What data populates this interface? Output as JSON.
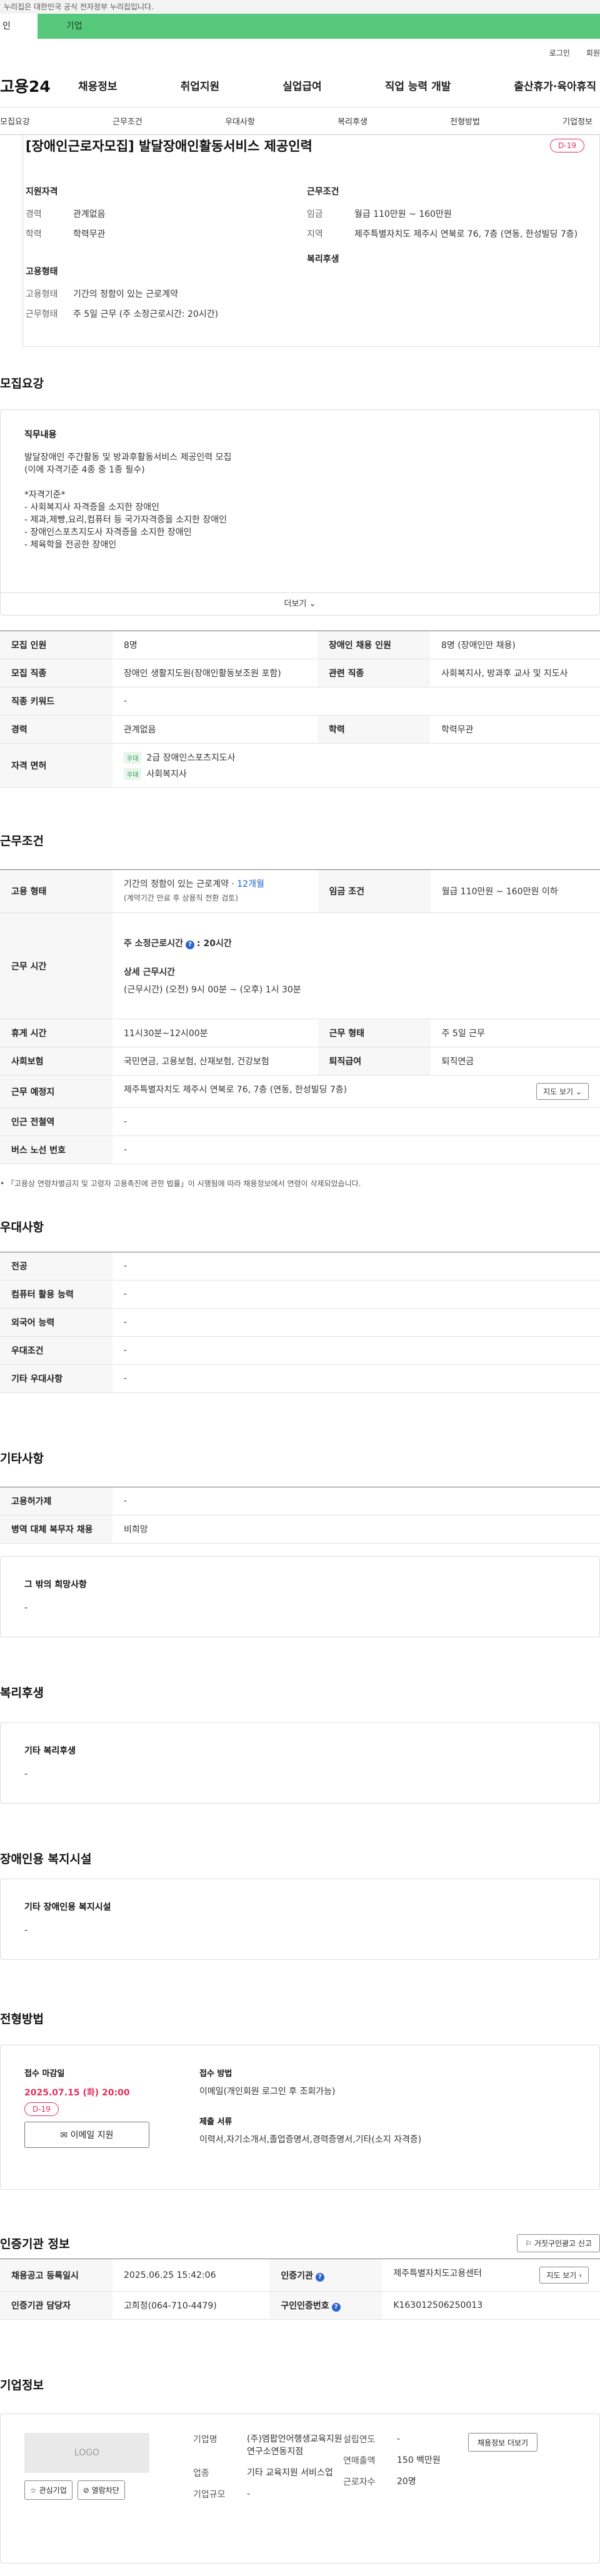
{
  "gov_notice": "누리집은 대한민국 공식 전자정부 누리집입니다.",
  "top_tabs": {
    "personal": "인",
    "company": "기업"
  },
  "util": {
    "login": "로그인",
    "join": "회원"
  },
  "gnb": {
    "logo": "고용24",
    "items": [
      "채용정보",
      "취업지원",
      "실업급여",
      "직업 능력 개발",
      "출산휴가·육아휴직"
    ]
  },
  "subnav": [
    "모집요강",
    "근무조건",
    "우대사항",
    "복리후생",
    "전형방법",
    "기업정보"
  ],
  "header": {
    "title": "[장애인근로자모집] 발달장애인활동서비스 제공인력",
    "dday": "D-19"
  },
  "summary": {
    "qual_title": "지원자격",
    "career_k": "경력",
    "career_v": "관계없음",
    "edu_k": "학력",
    "edu_v": "학력무관",
    "emp_title": "고용형태",
    "emptype_k": "고용형태",
    "emptype_v": "기간의 정함이 있는 근로계약",
    "worktype_k": "근무형태",
    "worktype_v": "주 5일 근무 (주 소정근로시간: 20시간)",
    "cond_title": "근무조건",
    "wage_k": "임금",
    "wage_v": "월급 110만원 ~ 160만원",
    "region_k": "지역",
    "region_v": "제주특별자치도 제주시 연북로 76, 7층 (연동, 한성빌딩 7층)",
    "welfare_title": "복리후생"
  },
  "recruit": {
    "section_title": "모집요강",
    "job_title": "직무내용",
    "job_lines": [
      "발달장애인 주간활동 및 방과후활동서비스 제공인력 모집",
      "(이에 자격기준 4종 중 1종 필수)",
      "",
      "*자격기준*",
      "- 사회복지사 자격증을 소지한 장애인",
      "- 제과,제빵,요리,컴퓨터 등 국가자격증을 소지한 장애인",
      "- 장애인스포츠지도사 자격증을 소지한 장애인",
      "- 체육학을 전공한 장애인"
    ],
    "more": "더보기",
    "headcount_k": "모집 인원",
    "headcount_v": "8명",
    "disabled_k": "장애인 채용 인원",
    "disabled_v": "8명 (장애인만 채용)",
    "jobcat_k": "모집 직종",
    "jobcat_v": "장애인 생활지도원(장애인활동보조원 포함)",
    "related_k": "관련 직종",
    "related_v": "사회복지사, 방과후 교사 및 지도사",
    "keyword_k": "직종 키워드",
    "keyword_v": "-",
    "career_k": "경력",
    "career_v": "관계없음",
    "edu_k": "학력",
    "edu_v": "학력무관",
    "license_k": "자격 면허",
    "licenses": [
      {
        "badge": "우대",
        "name": "2급 장애인스포츠지도사"
      },
      {
        "badge": "우대",
        "name": "사회복지사"
      }
    ]
  },
  "conditions": {
    "section_title": "근무조건",
    "emp_k": "고용 형태",
    "emp_v": "기간의 정함이 있는 근로계약 · ",
    "emp_months": "12개월",
    "emp_sub": "(계약기간 만료 후 상용직 전환 검토)",
    "wage_k": "임금 조건",
    "wage_v": "월급 110만원 ~ 160만원 이하",
    "hours_k": "근무 시간",
    "weekly_lbl": "주 소정근로시간",
    "weekly_v": ": 20시간",
    "detail_lbl": "상세 근무시간",
    "detail_v": "(근무시간) (오전) 9시 00분 ~ (오후) 1시 30분",
    "break_k": "휴게 시간",
    "break_v": "11시30분~12시00분",
    "form_k": "근무 형태",
    "form_v": "주 5일 근무",
    "ins_k": "사회보험",
    "ins_v": "국민연금, 고용보험, 산재보험, 건강보험",
    "sev_k": "퇴직급여",
    "sev_v": "퇴직연금",
    "place_k": "근무 예정지",
    "place_v": "제주특별자치도 제주시 연북로 76, 7층 (연동, 한성빌딩 7층)",
    "map_btn": "지도 보기",
    "subway_k": "인근 전철역",
    "subway_v": "-",
    "bus_k": "버스 노선 번호",
    "bus_v": "-",
    "note": "「고용상 연령차별금지 및 고령자 고용촉진에 관한 법률」이 시행됨에 따라 채용정보에서 연령이 삭제되었습니다."
  },
  "preference": {
    "section_title": "우대사항",
    "rows": [
      {
        "k": "전공",
        "v": "-"
      },
      {
        "k": "컴퓨터 활용 능력",
        "v": "-"
      },
      {
        "k": "외국어 능력",
        "v": "-"
      },
      {
        "k": "우대조건",
        "v": "-"
      },
      {
        "k": "기타 우대사항",
        "v": "-"
      }
    ]
  },
  "etc": {
    "section_title": "기타사항",
    "rows": [
      {
        "k": "고용허가제",
        "v": "-"
      },
      {
        "k": "병역 대체 복무자 채용",
        "v": "비희망"
      }
    ],
    "wish_title": "그 밖의 희망사항",
    "wish_v": "-"
  },
  "welfare": {
    "section_title": "복리후생",
    "box_title": "기타 복리후생",
    "box_v": "-"
  },
  "facility": {
    "section_title": "장애인용 복지시설",
    "box_title": "기타 장애인용 복지시설",
    "box_v": "-"
  },
  "process": {
    "section_title": "전형방법",
    "deadline_lbl": "접수 마감일",
    "deadline_v": "2025.07.15 (화) 20:00",
    "dday": "D-19",
    "email_btn": "이메일 지원",
    "method_lbl": "접수 방법",
    "method_v": "이메일(개인회원 로그인 후 조회가능)",
    "docs_lbl": "제출 서류",
    "docs_v": "이력서,자기소개서,졸업증명서,경력증명서,기타(소지 자격증)"
  },
  "agency": {
    "section_title": "인증기관 정보",
    "report_btn": "거짓구인광고 신고",
    "date_k": "채용공고 등록일시",
    "date_v": "2025.06.25 15:42:06",
    "org_k": "인증기관",
    "org_v": "제주특별자치도고용센터",
    "manager_k": "인증기관 담당자",
    "manager_v": "고희정(064-710-4479)",
    "id_k": "구인인증번호",
    "id_v": "K163012506250013",
    "map_btn": "지도 보기"
  },
  "company": {
    "section_title": "기업정보",
    "logo": "LOGO",
    "fav_btn": "관심기업",
    "block_btn": "열람차단",
    "name_k": "기업명",
    "name_v": "(주)엠팝언어행생교육지원연구소연동지점",
    "industry_k": "업종",
    "industry_v": "기타 교육지원 서비스업",
    "size_k": "기업규모",
    "size_v": "-",
    "year_k": "설립연도",
    "year_v": "-",
    "sales_k": "연매출액",
    "sales_v": "150 백만원",
    "workers_k": "근로자수",
    "workers_v": "20명",
    "jobs_btn": "채용정보 더보기"
  }
}
